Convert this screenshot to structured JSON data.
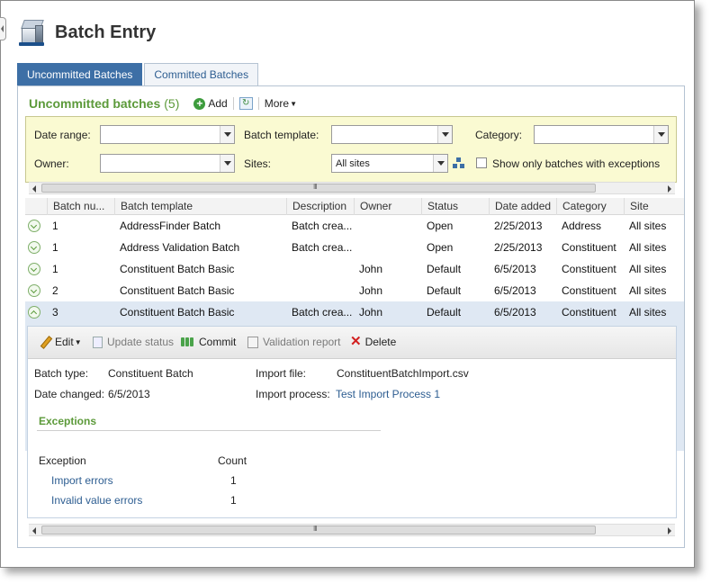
{
  "page": {
    "title": "Batch Entry"
  },
  "tabs": [
    {
      "label": "Uncommitted Batches",
      "active": true
    },
    {
      "label": "Committed Batches",
      "active": false
    }
  ],
  "panel": {
    "title": "Uncommitted batches",
    "count": "(5)",
    "add_label": "Add",
    "more_label": "More"
  },
  "filters": {
    "date_range_label": "Date range:",
    "date_range_value": "",
    "batch_template_label": "Batch template:",
    "batch_template_value": "",
    "category_label": "Category:",
    "category_value": "",
    "owner_label": "Owner:",
    "owner_value": "",
    "sites_label": "Sites:",
    "sites_value": "All sites",
    "exceptions_label": "Show only batches with exceptions",
    "exceptions_checked": false
  },
  "grid": {
    "columns": [
      "Batch nu...",
      "Batch template",
      "Description",
      "Owner",
      "Status",
      "Date added",
      "Category",
      "Site"
    ],
    "rows": [
      {
        "num": "1",
        "template": "AddressFinder Batch",
        "description": "Batch crea...",
        "owner": "",
        "status": "Open",
        "date": "2/25/2013",
        "category": "Address",
        "site": "All sites"
      },
      {
        "num": "1",
        "template": "Address Validation Batch",
        "description": "Batch crea...",
        "owner": "",
        "status": "Open",
        "date": "2/25/2013",
        "category": "Constituent",
        "site": "All sites"
      },
      {
        "num": "1",
        "template": "Constituent Batch Basic",
        "description": "",
        "owner": "John",
        "status": "Default",
        "date": "6/5/2013",
        "category": "Constituent",
        "site": "All sites"
      },
      {
        "num": "2",
        "template": "Constituent Batch Basic",
        "description": "",
        "owner": "John",
        "status": "Default",
        "date": "6/5/2013",
        "category": "Constituent",
        "site": "All sites"
      },
      {
        "num": "3",
        "template": "Constituent Batch Basic",
        "description": "Batch crea...",
        "owner": "John",
        "status": "Default",
        "date": "6/5/2013",
        "category": "Constituent",
        "site": "All sites"
      }
    ]
  },
  "detail": {
    "toolbar": {
      "edit": "Edit",
      "update_status": "Update status",
      "commit": "Commit",
      "validation_report": "Validation report",
      "delete": "Delete"
    },
    "batch_type_label": "Batch type:",
    "batch_type_value": "Constituent Batch",
    "date_changed_label": "Date changed:",
    "date_changed_value": "6/5/2013",
    "import_file_label": "Import file:",
    "import_file_value": "ConstituentBatchImport.csv",
    "import_process_label": "Import process:",
    "import_process_value": "Test Import Process 1",
    "exceptions_title": "Exceptions",
    "exceptions_header": {
      "exception": "Exception",
      "count": "Count"
    },
    "exceptions": [
      {
        "name": "Import errors",
        "count": "1"
      },
      {
        "name": "Invalid value errors",
        "count": "1"
      }
    ]
  },
  "colors": {
    "accent": "#3d6fa6",
    "green": "#5c9a3a",
    "filter_bg": "#fafad2"
  },
  "icons": [
    "batch-entry-icon",
    "add-icon",
    "refresh-icon",
    "sites-icon",
    "expand-icon",
    "collapse-icon",
    "pencil-icon",
    "document-icon",
    "commit-icon",
    "report-icon",
    "delete-icon"
  ]
}
